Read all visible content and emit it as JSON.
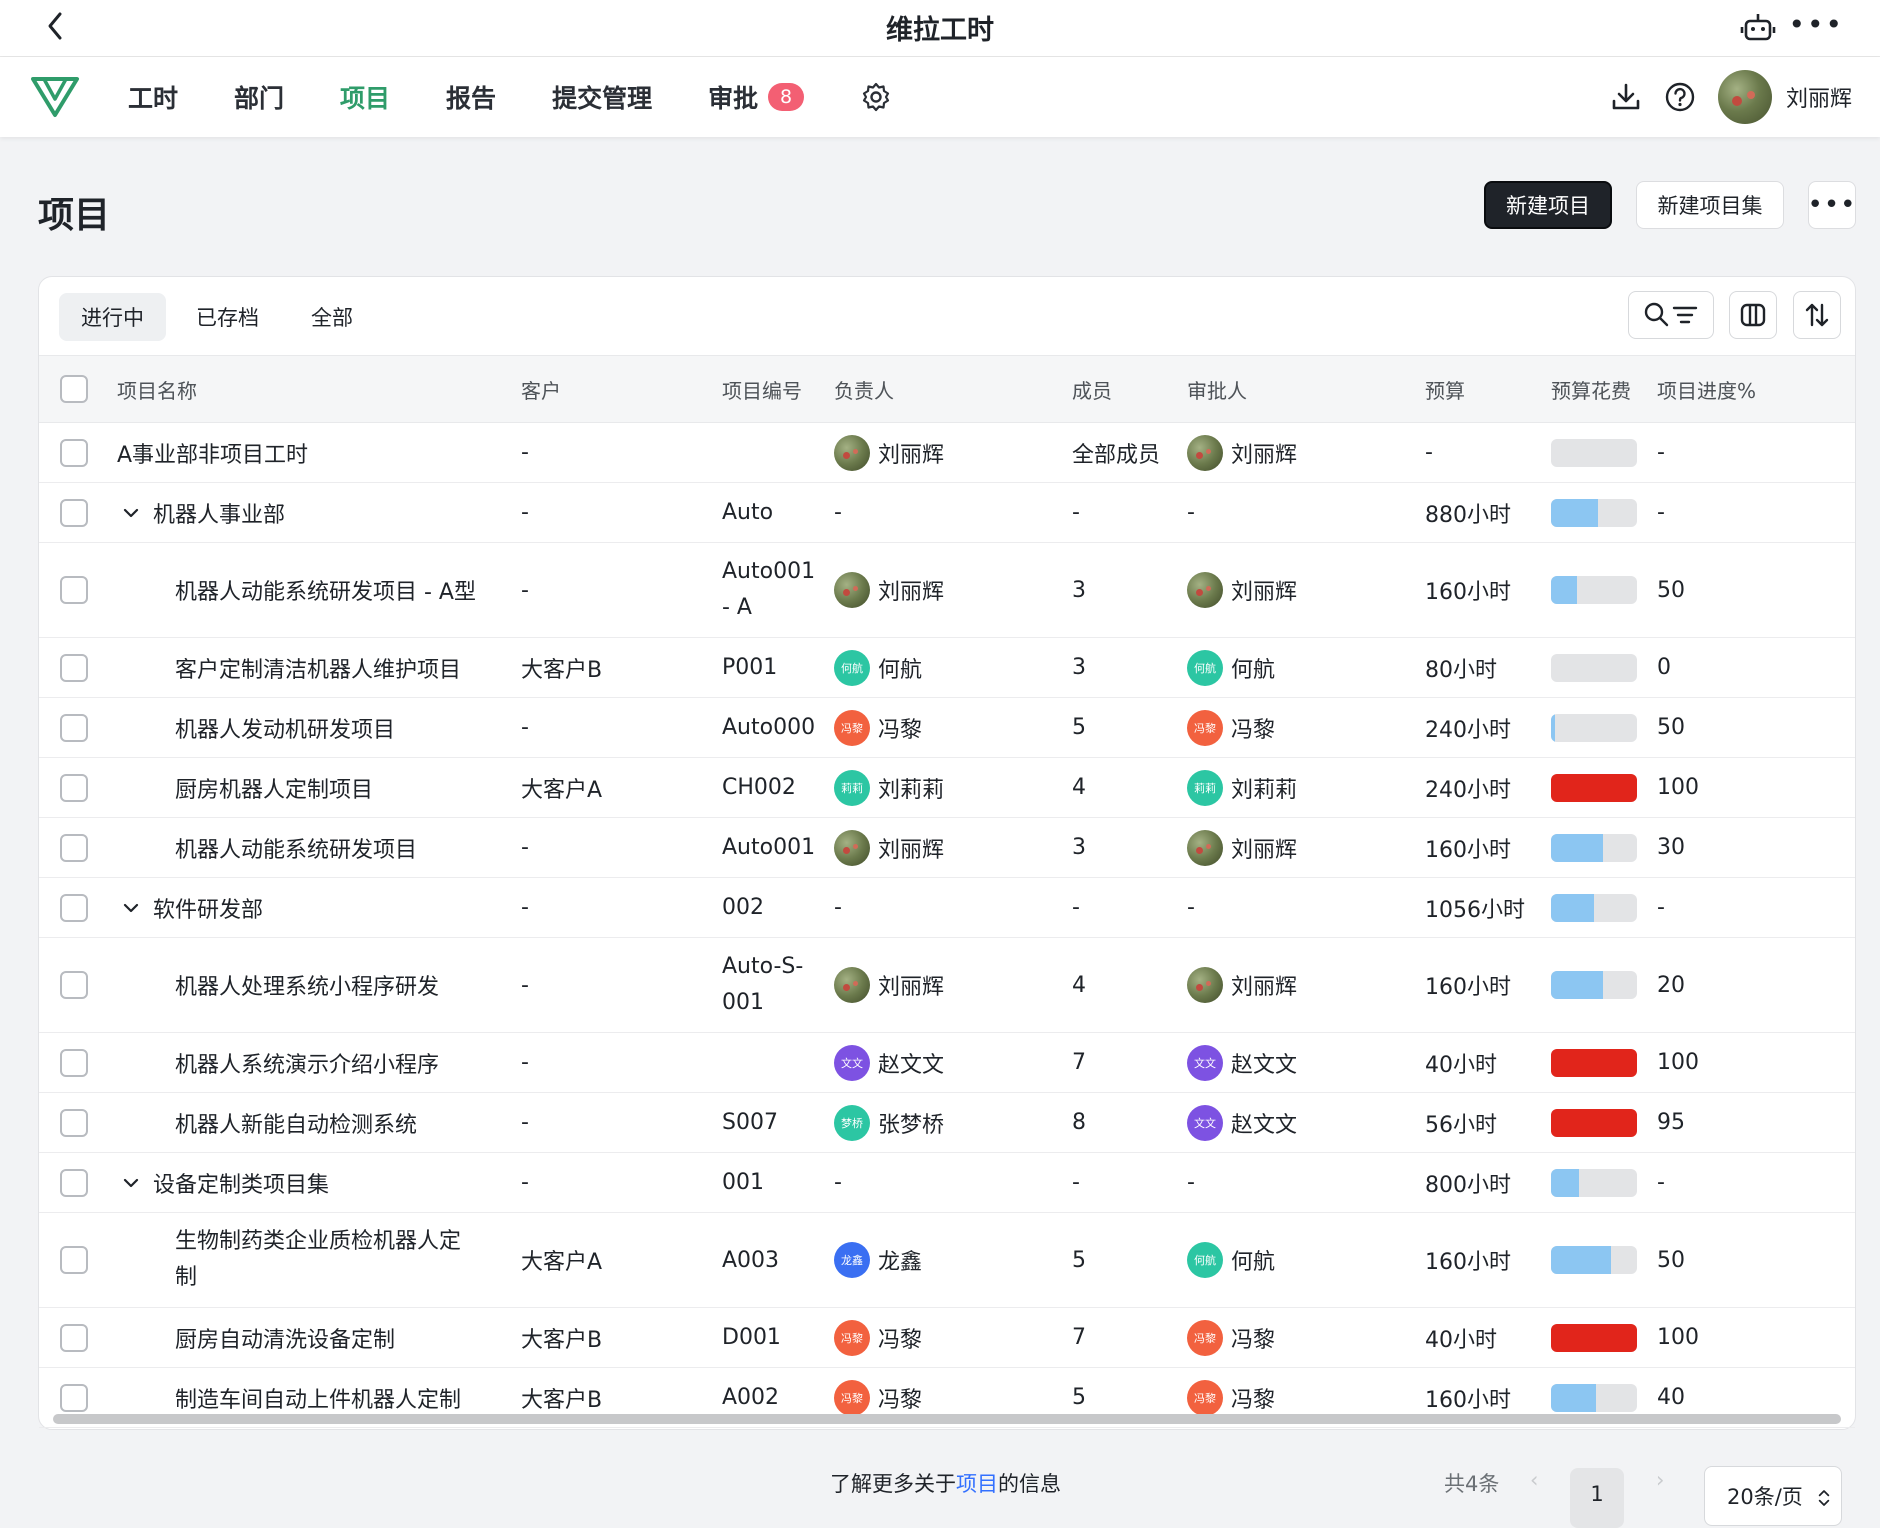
{
  "window": {
    "title": "维拉工时"
  },
  "nav": {
    "items": [
      {
        "id": "worktime",
        "label": "工时",
        "active": false
      },
      {
        "id": "department",
        "label": "部门",
        "active": false
      },
      {
        "id": "projects",
        "label": "项目",
        "active": true
      },
      {
        "id": "reports",
        "label": "报告",
        "active": false
      },
      {
        "id": "submission",
        "label": "提交管理",
        "active": false
      },
      {
        "id": "approval",
        "label": "审批",
        "active": false,
        "badge": "8"
      }
    ],
    "user_name": "刘丽辉",
    "accent_color": "#2f9c6a",
    "badge_color": "#f35f73"
  },
  "page": {
    "title": "项目",
    "new_project_label": "新建项目",
    "new_project_set_label": "新建项目集"
  },
  "tabs": [
    {
      "label": "进行中",
      "active": true
    },
    {
      "label": "已存档",
      "active": false
    },
    {
      "label": "全部",
      "active": false
    }
  ],
  "table": {
    "headers": {
      "name": "项目名称",
      "client": "客户",
      "code": "项目编号",
      "owner": "负责人",
      "members": "成员",
      "approver": "审批人",
      "budget": "预算",
      "spent": "预算花费",
      "progress": "项目进度%"
    },
    "rows": [
      {
        "level": 0,
        "group": false,
        "name": "A事业部非项目工时",
        "client": "-",
        "code": "",
        "owner": "刘丽辉",
        "owner_avatar": "photo",
        "owner_initials": "",
        "members": "全部成员",
        "approver": "刘丽辉",
        "approver_avatar": "photo",
        "approver_initials": "",
        "budget": "-",
        "spent_pct": 0,
        "progress": "-"
      },
      {
        "level": 0,
        "group": true,
        "name": "机器人事业部",
        "client": "-",
        "code": "Auto",
        "owner": "-",
        "owner_avatar": "",
        "owner_initials": "",
        "members": "-",
        "approver": "-",
        "approver_avatar": "",
        "approver_initials": "",
        "budget": "880小时",
        "spent_pct": 55,
        "progress": "-"
      },
      {
        "level": 1,
        "group": false,
        "name": "机器人动能系统研发项目 - A型",
        "client": "-",
        "code": "Auto001\n- A",
        "owner": "刘丽辉",
        "owner_avatar": "photo",
        "owner_initials": "",
        "members": "3",
        "approver": "刘丽辉",
        "approver_avatar": "photo",
        "approver_initials": "",
        "budget": "160小时",
        "spent_pct": 30,
        "progress": "50"
      },
      {
        "level": 1,
        "group": false,
        "name": "客户定制清洁机器人维护项目",
        "client": "大客户B",
        "code": "P001",
        "owner": "何航",
        "owner_avatar": "teal",
        "owner_initials": "何航",
        "members": "3",
        "approver": "何航",
        "approver_avatar": "teal",
        "approver_initials": "何航",
        "budget": "80小时",
        "spent_pct": 0,
        "progress": "0"
      },
      {
        "level": 1,
        "group": false,
        "name": "机器人发动机研发项目",
        "client": "-",
        "code": "Auto000",
        "owner": "冯黎",
        "owner_avatar": "orange",
        "owner_initials": "冯黎",
        "members": "5",
        "approver": "冯黎",
        "approver_avatar": "orange",
        "approver_initials": "冯黎",
        "budget": "240小时",
        "spent_pct": 5,
        "progress": "50"
      },
      {
        "level": 1,
        "group": false,
        "name": "厨房机器人定制项目",
        "client": "大客户A",
        "code": "CH002",
        "owner": "刘莉莉",
        "owner_avatar": "teal",
        "owner_initials": "莉莉",
        "members": "4",
        "approver": "刘莉莉",
        "approver_avatar": "teal",
        "approver_initials": "莉莉",
        "budget": "240小时",
        "spent_pct": 100,
        "progress": "100"
      },
      {
        "level": 1,
        "group": false,
        "name": "机器人动能系统研发项目",
        "client": "-",
        "code": "Auto001",
        "owner": "刘丽辉",
        "owner_avatar": "photo",
        "owner_initials": "",
        "members": "3",
        "approver": "刘丽辉",
        "approver_avatar": "photo",
        "approver_initials": "",
        "budget": "160小时",
        "spent_pct": 60,
        "progress": "30"
      },
      {
        "level": 0,
        "group": true,
        "name": "软件研发部",
        "client": "-",
        "code": "002",
        "owner": "-",
        "owner_avatar": "",
        "owner_initials": "",
        "members": "-",
        "approver": "-",
        "approver_avatar": "",
        "approver_initials": "",
        "budget": "1056小时",
        "spent_pct": 50,
        "progress": "-"
      },
      {
        "level": 1,
        "group": false,
        "name": "机器人处理系统小程序研发",
        "client": "-",
        "code": "Auto-S-\n001",
        "owner": "刘丽辉",
        "owner_avatar": "photo",
        "owner_initials": "",
        "members": "4",
        "approver": "刘丽辉",
        "approver_avatar": "photo",
        "approver_initials": "",
        "budget": "160小时",
        "spent_pct": 60,
        "progress": "20"
      },
      {
        "level": 1,
        "group": false,
        "name": "机器人系统演示介绍小程序",
        "client": "-",
        "code": "",
        "owner": "赵文文",
        "owner_avatar": "purple",
        "owner_initials": "文文",
        "members": "7",
        "approver": "赵文文",
        "approver_avatar": "purple",
        "approver_initials": "文文",
        "budget": "40小时",
        "spent_pct": 100,
        "progress": "100"
      },
      {
        "level": 1,
        "group": false,
        "name": "机器人新能自动检测系统",
        "client": "-",
        "code": "S007",
        "owner": "张梦桥",
        "owner_avatar": "teal",
        "owner_initials": "梦桥",
        "members": "8",
        "approver": "赵文文",
        "approver_avatar": "purple",
        "approver_initials": "文文",
        "budget": "56小时",
        "spent_pct": 100,
        "progress": "95"
      },
      {
        "level": 0,
        "group": true,
        "name": "设备定制类项目集",
        "client": "-",
        "code": "001",
        "owner": "-",
        "owner_avatar": "",
        "owner_initials": "",
        "members": "-",
        "approver": "-",
        "approver_avatar": "",
        "approver_initials": "",
        "budget": "800小时",
        "spent_pct": 32,
        "progress": "-"
      },
      {
        "level": 1,
        "group": false,
        "name": "生物制药类企业质检机器人定\n制",
        "client": "大客户A",
        "code": "A003",
        "owner": "龙鑫",
        "owner_avatar": "blue",
        "owner_initials": "龙鑫",
        "members": "5",
        "approver": "何航",
        "approver_avatar": "teal",
        "approver_initials": "何航",
        "budget": "160小时",
        "spent_pct": 70,
        "progress": "50"
      },
      {
        "level": 1,
        "group": false,
        "name": "厨房自动清洗设备定制",
        "client": "大客户B",
        "code": "D001",
        "owner": "冯黎",
        "owner_avatar": "orange",
        "owner_initials": "冯黎",
        "members": "7",
        "approver": "冯黎",
        "approver_avatar": "orange",
        "approver_initials": "冯黎",
        "budget": "40小时",
        "spent_pct": 100,
        "progress": "100"
      },
      {
        "level": 1,
        "group": false,
        "name": "制造车间自动上件机器人定制",
        "client": "大客户B",
        "code": "A002",
        "owner": "冯黎",
        "owner_avatar": "orange",
        "owner_initials": "冯黎",
        "members": "5",
        "approver": "冯黎",
        "approver_avatar": "orange",
        "approver_initials": "冯黎",
        "budget": "160小时",
        "spent_pct": 52,
        "progress": "40"
      }
    ]
  },
  "footer": {
    "info_prefix": "了解更多关于",
    "info_link": "项目",
    "info_suffix": "的信息",
    "total": "共4条",
    "prev": "‹",
    "current_page": "1",
    "next": "›",
    "page_size": "20条/页"
  },
  "icons": [
    "back-icon",
    "robot-icon",
    "more-icon",
    "logo-icon",
    "gear-icon",
    "download-icon",
    "help-icon",
    "search-icon",
    "filter-icon",
    "columns-icon",
    "sort-icon",
    "chevron-down-icon"
  ]
}
